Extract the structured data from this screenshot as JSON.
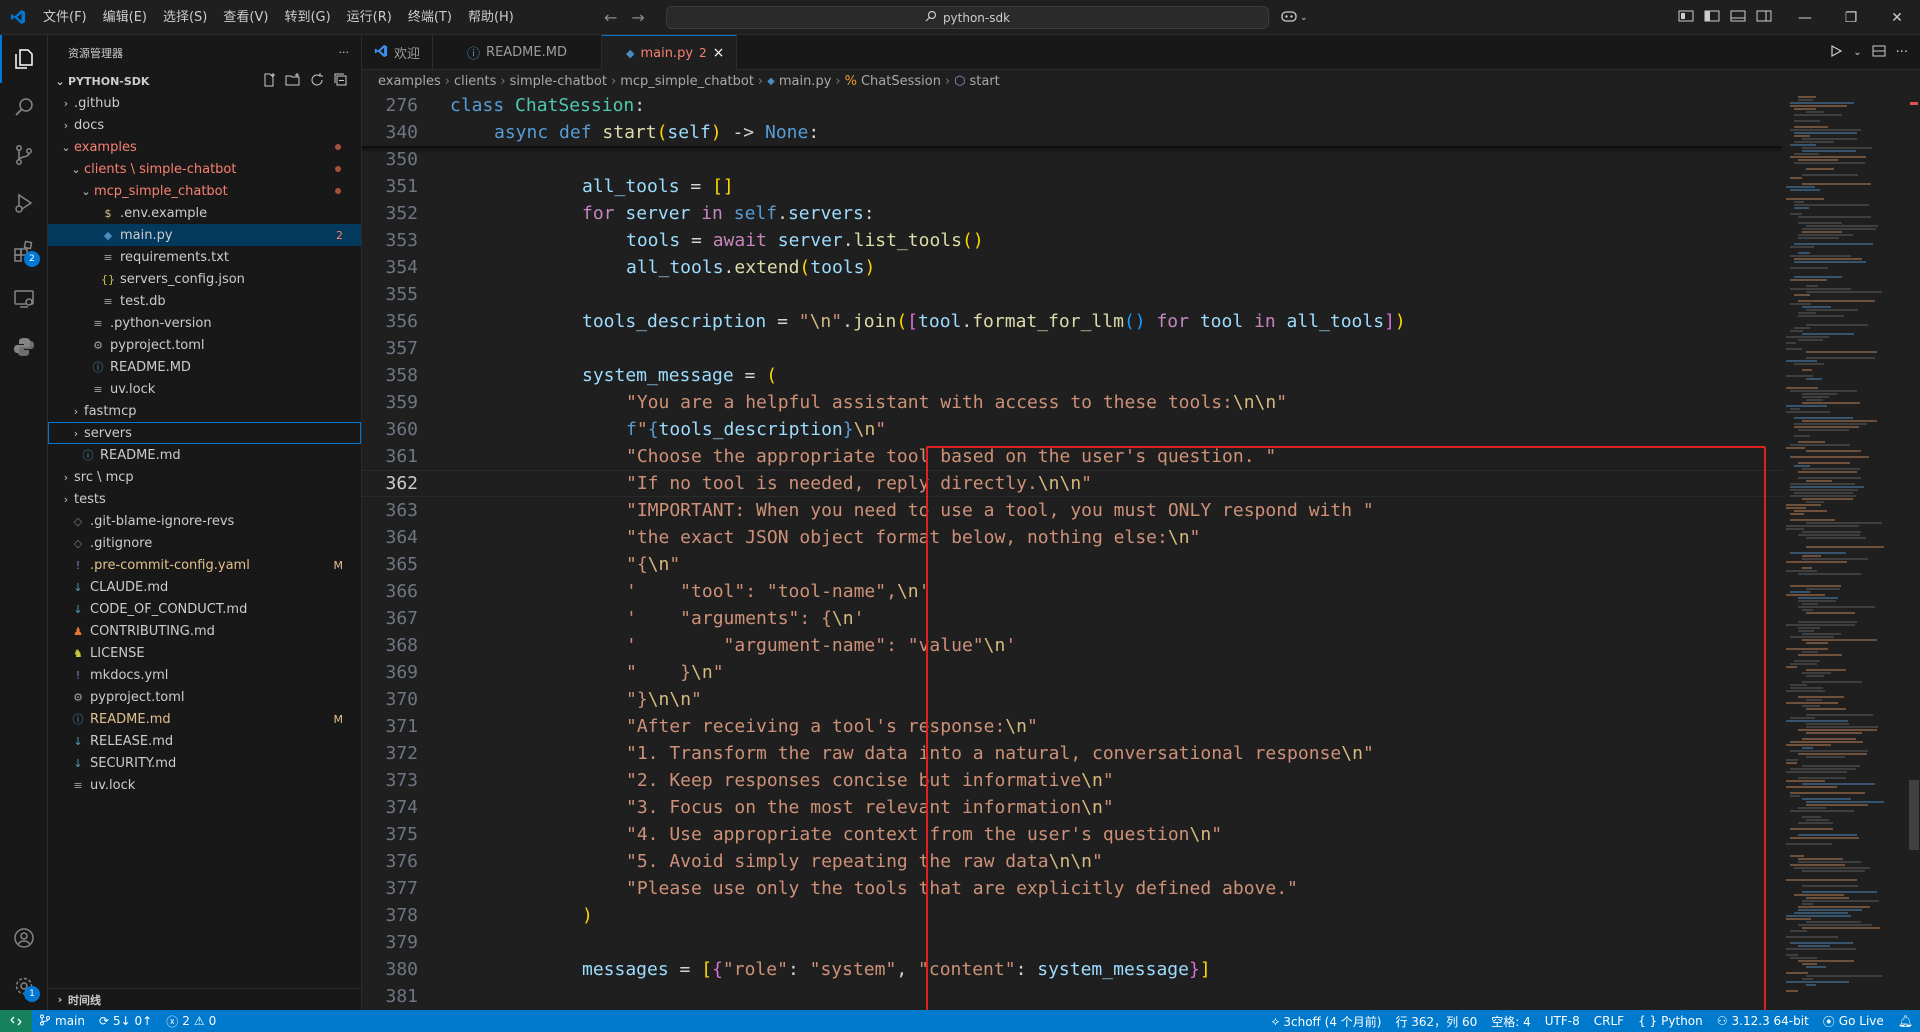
{
  "window": {
    "menu": [
      "文件(F)",
      "编辑(E)",
      "选择(S)",
      "查看(V)",
      "转到(G)",
      "运行(R)",
      "终端(T)",
      "帮助(H)"
    ],
    "search": "python-sdk"
  },
  "colors": {
    "accent": "#0078d4",
    "statusbar": "#007acc",
    "highlight_box": "#e02020"
  },
  "activity_bar": {
    "items": [
      "explorer-icon",
      "search-icon",
      "source-control-icon",
      "run-debug-icon",
      "extensions-icon",
      "remote-explorer-icon",
      "python-icon"
    ],
    "extensions_badge": "2",
    "settings_badge": "1"
  },
  "sidebar": {
    "title": "资源管理器",
    "more": "···",
    "section": "PYTHON-SDK",
    "timeline": "时间线",
    "tree": [
      {
        "depth": 0,
        "kind": "folder",
        "open": false,
        "name": ".github"
      },
      {
        "depth": 0,
        "kind": "folder",
        "open": false,
        "name": "docs"
      },
      {
        "depth": 0,
        "kind": "folder",
        "open": true,
        "name": "examples",
        "state": "error",
        "dot": true
      },
      {
        "depth": 1,
        "kind": "folder",
        "open": true,
        "name": "clients \\ simple-chatbot",
        "state": "error",
        "dot": true
      },
      {
        "depth": 2,
        "kind": "folder",
        "open": true,
        "name": "mcp_simple_chatbot",
        "state": "error",
        "dot": true
      },
      {
        "depth": 3,
        "kind": "file",
        "icon": "$",
        "icon_color": "#e2c08d",
        "name": ".env.example"
      },
      {
        "depth": 3,
        "kind": "file",
        "icon": "py",
        "icon_color": "#4b8bbe",
        "name": "main.py",
        "deco": "2",
        "selected": true
      },
      {
        "depth": 3,
        "kind": "file",
        "icon": "≡",
        "icon_color": "#a0a0a0",
        "name": "requirements.txt"
      },
      {
        "depth": 3,
        "kind": "file",
        "icon": "{}",
        "icon_color": "#cbcb41",
        "name": "servers_config.json"
      },
      {
        "depth": 3,
        "kind": "file",
        "icon": "≡",
        "icon_color": "#a0a0a0",
        "name": "test.db"
      },
      {
        "depth": 2,
        "kind": "file",
        "icon": "≡",
        "icon_color": "#a0a0a0",
        "name": ".python-version"
      },
      {
        "depth": 2,
        "kind": "file",
        "icon": "⚙",
        "icon_color": "#a0a0a0",
        "name": "pyproject.toml"
      },
      {
        "depth": 2,
        "kind": "file",
        "icon": "ⓘ",
        "icon_color": "#519aba",
        "name": "README.MD"
      },
      {
        "depth": 2,
        "kind": "file",
        "icon": "≡",
        "icon_color": "#a0a0a0",
        "name": "uv.lock"
      },
      {
        "depth": 1,
        "kind": "folder",
        "open": false,
        "name": "fastmcp"
      },
      {
        "depth": 1,
        "kind": "folder",
        "open": false,
        "name": "servers",
        "focused": true
      },
      {
        "depth": 1,
        "kind": "file",
        "icon": "ⓘ",
        "icon_color": "#519aba",
        "name": "README.md"
      },
      {
        "depth": 0,
        "kind": "folder",
        "open": false,
        "name": "src \\ mcp"
      },
      {
        "depth": 0,
        "kind": "folder",
        "open": false,
        "name": "tests"
      },
      {
        "depth": 0,
        "kind": "file",
        "icon": "◇",
        "icon_color": "#6d8086",
        "name": ".git-blame-ignore-revs"
      },
      {
        "depth": 0,
        "kind": "file",
        "icon": "◇",
        "icon_color": "#6d8086",
        "name": ".gitignore"
      },
      {
        "depth": 0,
        "kind": "file",
        "icon": "!",
        "icon_color": "#a074c4",
        "name": ".pre-commit-config.yaml",
        "deco": "M",
        "state": "modified"
      },
      {
        "depth": 0,
        "kind": "file",
        "icon": "↓",
        "icon_color": "#519aba",
        "name": "CLAUDE.md"
      },
      {
        "depth": 0,
        "kind": "file",
        "icon": "↓",
        "icon_color": "#519aba",
        "name": "CODE_OF_CONDUCT.md"
      },
      {
        "depth": 0,
        "kind": "file",
        "icon": "♟",
        "icon_color": "#e37933",
        "name": "CONTRIBUTING.md"
      },
      {
        "depth": 0,
        "kind": "file",
        "icon": "♞",
        "icon_color": "#cbcb41",
        "name": "LICENSE"
      },
      {
        "depth": 0,
        "kind": "file",
        "icon": "!",
        "icon_color": "#a074c4",
        "name": "mkdocs.yml"
      },
      {
        "depth": 0,
        "kind": "file",
        "icon": "⚙",
        "icon_color": "#a0a0a0",
        "name": "pyproject.toml"
      },
      {
        "depth": 0,
        "kind": "file",
        "icon": "ⓘ",
        "icon_color": "#519aba",
        "name": "README.md",
        "deco": "M",
        "state": "modified"
      },
      {
        "depth": 0,
        "kind": "file",
        "icon": "↓",
        "icon_color": "#519aba",
        "name": "RELEASE.md"
      },
      {
        "depth": 0,
        "kind": "file",
        "icon": "↓",
        "icon_color": "#519aba",
        "name": "SECURITY.md"
      },
      {
        "depth": 0,
        "kind": "file",
        "icon": "≡",
        "icon_color": "#a0a0a0",
        "name": "uv.lock"
      }
    ]
  },
  "tabs": [
    {
      "label": "欢迎",
      "icon": "vscode-icon",
      "active": false
    },
    {
      "label": "README.MD",
      "icon": "info-icon",
      "active": false
    },
    {
      "label": "main.py",
      "icon": "python-file-icon",
      "active": true,
      "problems": "2",
      "close": "×"
    }
  ],
  "breadcrumb": [
    "examples",
    "clients",
    "simple-chatbot",
    "mcp_simple_chatbot",
    "main.py",
    "ChatSession",
    "start"
  ],
  "editor": {
    "current_line": "362",
    "lines": [
      {
        "n": "276",
        "indent": 0,
        "sticky": true,
        "tokens": [
          [
            "k",
            "class "
          ],
          [
            "cl",
            "ChatSession"
          ],
          [
            "t",
            ":"
          ]
        ]
      },
      {
        "n": "340",
        "indent": 1,
        "sticky": true,
        "tokens": [
          [
            "k",
            "async "
          ],
          [
            "k",
            "def "
          ],
          [
            "f",
            "start"
          ],
          [
            "b1",
            "("
          ],
          [
            "v",
            "self"
          ],
          [
            "b1",
            ")"
          ],
          [
            "t",
            " -> "
          ],
          [
            "k",
            "None"
          ],
          [
            "t",
            ":"
          ]
        ]
      },
      {
        "n": "350",
        "indent": 0,
        "tokens": []
      },
      {
        "n": "351",
        "indent": 3,
        "tokens": [
          [
            "v",
            "all_tools"
          ],
          [
            "t",
            " = "
          ],
          [
            "b1",
            "[]"
          ]
        ]
      },
      {
        "n": "352",
        "indent": 3,
        "tokens": [
          [
            "c",
            "for "
          ],
          [
            "v",
            "server "
          ],
          [
            "c",
            "in "
          ],
          [
            "k",
            "self"
          ],
          [
            "t",
            "."
          ],
          [
            "v",
            "servers"
          ],
          [
            "t",
            ":"
          ]
        ]
      },
      {
        "n": "353",
        "indent": 4,
        "tokens": [
          [
            "v",
            "tools"
          ],
          [
            "t",
            " = "
          ],
          [
            "c",
            "await "
          ],
          [
            "v",
            "server"
          ],
          [
            "t",
            "."
          ],
          [
            "f",
            "list_tools"
          ],
          [
            "b1",
            "()"
          ]
        ]
      },
      {
        "n": "354",
        "indent": 4,
        "tokens": [
          [
            "v",
            "all_tools"
          ],
          [
            "t",
            "."
          ],
          [
            "f",
            "extend"
          ],
          [
            "b1",
            "("
          ],
          [
            "v",
            "tools"
          ],
          [
            "b1",
            ")"
          ]
        ]
      },
      {
        "n": "355",
        "indent": 0,
        "tokens": []
      },
      {
        "n": "356",
        "indent": 3,
        "tokens": [
          [
            "v",
            "tools_description"
          ],
          [
            "t",
            " = "
          ],
          [
            "s",
            "\""
          ],
          [
            "esc",
            "\\n"
          ],
          [
            "s",
            "\""
          ],
          [
            "t",
            "."
          ],
          [
            "f",
            "join"
          ],
          [
            "b1",
            "("
          ],
          [
            "b2",
            "["
          ],
          [
            "v",
            "tool"
          ],
          [
            "t",
            "."
          ],
          [
            "f",
            "format_for_llm"
          ],
          [
            "b3",
            "()"
          ],
          [
            "c",
            " for "
          ],
          [
            "v",
            "tool "
          ],
          [
            "c",
            "in "
          ],
          [
            "v",
            "all_tools"
          ],
          [
            "b2",
            "]"
          ],
          [
            "b1",
            ")"
          ]
        ]
      },
      {
        "n": "357",
        "indent": 0,
        "tokens": []
      },
      {
        "n": "358",
        "indent": 3,
        "tokens": [
          [
            "v",
            "system_message"
          ],
          [
            "t",
            " = "
          ],
          [
            "b1",
            "("
          ]
        ]
      },
      {
        "n": "359",
        "indent": 4,
        "tokens": [
          [
            "s",
            "\"You are a helpful assistant with access to these tools:"
          ],
          [
            "esc",
            "\\n\\n"
          ],
          [
            "s",
            "\""
          ]
        ]
      },
      {
        "n": "360",
        "indent": 4,
        "tokens": [
          [
            "k",
            "f"
          ],
          [
            "s",
            "\""
          ],
          [
            "k",
            "{"
          ],
          [
            "v",
            "tools_description"
          ],
          [
            "k",
            "}"
          ],
          [
            "esc",
            "\\n"
          ],
          [
            "s",
            "\""
          ]
        ]
      },
      {
        "n": "361",
        "indent": 4,
        "tokens": [
          [
            "s",
            "\"Choose the appropriate tool based on the user's question. \""
          ]
        ]
      },
      {
        "n": "362",
        "indent": 4,
        "tokens": [
          [
            "s",
            "\"If no tool is needed, reply directly."
          ],
          [
            "esc",
            "\\n\\n"
          ],
          [
            "s",
            "\""
          ]
        ]
      },
      {
        "n": "363",
        "indent": 4,
        "tokens": [
          [
            "s",
            "\"IMPORTANT: When you need to use a tool, you must ONLY respond with \""
          ]
        ]
      },
      {
        "n": "364",
        "indent": 4,
        "tokens": [
          [
            "s",
            "\"the exact JSON object format below, nothing else:"
          ],
          [
            "esc",
            "\\n"
          ],
          [
            "s",
            "\""
          ]
        ]
      },
      {
        "n": "365",
        "indent": 4,
        "tokens": [
          [
            "s",
            "\"{"
          ],
          [
            "esc",
            "\\n"
          ],
          [
            "s",
            "\""
          ]
        ]
      },
      {
        "n": "366",
        "indent": 4,
        "tokens": [
          [
            "s",
            "'    \"tool\": \"tool-name\","
          ],
          [
            "esc",
            "\\n"
          ],
          [
            "s",
            "'"
          ]
        ]
      },
      {
        "n": "367",
        "indent": 4,
        "tokens": [
          [
            "s",
            "'    \"arguments\": {"
          ],
          [
            "esc",
            "\\n"
          ],
          [
            "s",
            "'"
          ]
        ]
      },
      {
        "n": "368",
        "indent": 4,
        "tokens": [
          [
            "s",
            "'        \"argument-name\": \"value\""
          ],
          [
            "esc",
            "\\n"
          ],
          [
            "s",
            "'"
          ]
        ]
      },
      {
        "n": "369",
        "indent": 4,
        "tokens": [
          [
            "s",
            "\"    }"
          ],
          [
            "esc",
            "\\n"
          ],
          [
            "s",
            "\""
          ]
        ]
      },
      {
        "n": "370",
        "indent": 4,
        "tokens": [
          [
            "s",
            "\"}"
          ],
          [
            "esc",
            "\\n\\n"
          ],
          [
            "s",
            "\""
          ]
        ]
      },
      {
        "n": "371",
        "indent": 4,
        "tokens": [
          [
            "s",
            "\"After receiving a tool's response:"
          ],
          [
            "esc",
            "\\n"
          ],
          [
            "s",
            "\""
          ]
        ]
      },
      {
        "n": "372",
        "indent": 4,
        "tokens": [
          [
            "s",
            "\"1. Transform the raw data into a natural, conversational response"
          ],
          [
            "esc",
            "\\n"
          ],
          [
            "s",
            "\""
          ]
        ]
      },
      {
        "n": "373",
        "indent": 4,
        "tokens": [
          [
            "s",
            "\"2. Keep responses concise but informative"
          ],
          [
            "esc",
            "\\n"
          ],
          [
            "s",
            "\""
          ]
        ]
      },
      {
        "n": "374",
        "indent": 4,
        "tokens": [
          [
            "s",
            "\"3. Focus on the most relevant information"
          ],
          [
            "esc",
            "\\n"
          ],
          [
            "s",
            "\""
          ]
        ]
      },
      {
        "n": "375",
        "indent": 4,
        "tokens": [
          [
            "s",
            "\"4. Use appropriate context from the user's question"
          ],
          [
            "esc",
            "\\n"
          ],
          [
            "s",
            "\""
          ]
        ]
      },
      {
        "n": "376",
        "indent": 4,
        "tokens": [
          [
            "s",
            "\"5. Avoid simply repeating the raw data"
          ],
          [
            "esc",
            "\\n\\n"
          ],
          [
            "s",
            "\""
          ]
        ]
      },
      {
        "n": "377",
        "indent": 4,
        "tokens": [
          [
            "s",
            "\"Please use only the tools that are explicitly defined above.\""
          ]
        ]
      },
      {
        "n": "378",
        "indent": 3,
        "tokens": [
          [
            "b1",
            ")"
          ]
        ]
      },
      {
        "n": "379",
        "indent": 0,
        "tokens": []
      },
      {
        "n": "380",
        "indent": 3,
        "tokens": [
          [
            "v",
            "messages"
          ],
          [
            "t",
            " = "
          ],
          [
            "b1",
            "["
          ],
          [
            "b2",
            "{"
          ],
          [
            "s",
            "\"role\""
          ],
          [
            "t",
            ": "
          ],
          [
            "s",
            "\"system\""
          ],
          [
            "t",
            ", "
          ],
          [
            "s",
            "\"content\""
          ],
          [
            "t",
            ": "
          ],
          [
            "v",
            "system_message"
          ],
          [
            "b2",
            "}"
          ],
          [
            "b1",
            "]"
          ]
        ]
      },
      {
        "n": "381",
        "indent": 0,
        "tokens": []
      }
    ]
  },
  "statusbar": {
    "branch": "main",
    "sync": "5↓ 0↑",
    "errors": "2",
    "warnings": "0",
    "blame": "3choff (4 个月前)",
    "position": "行 362，列 60",
    "spaces": "空格: 4",
    "encoding": "UTF-8",
    "eol": "CRLF",
    "language": "Python",
    "interpreter": "3.12.3 64-bit",
    "golive": "Go Live"
  }
}
